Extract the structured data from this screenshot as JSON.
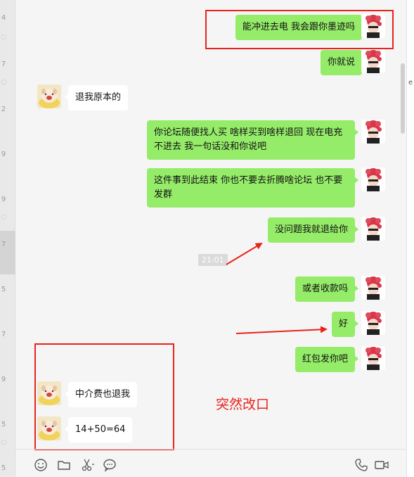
{
  "left_list_fragments": {
    "digits": [
      "4",
      "7",
      "2",
      "9",
      "9",
      "7",
      "5",
      "7",
      "9",
      "5",
      "5"
    ]
  },
  "right_fragment": "e",
  "messages": [
    {
      "sender": "me",
      "text": "能冲进去电 我会跟你墨迹吗"
    },
    {
      "sender": "me",
      "text": "你就说"
    },
    {
      "sender": "other",
      "text": "退我原本的"
    },
    {
      "sender": "me",
      "text": "你论坛随便找人买 啥样买到啥样退回 现在电充不进去 我一句话没和你说吧"
    },
    {
      "sender": "me",
      "text": "这件事到此结束 你也不要去折腾啥论坛 也不要发群"
    },
    {
      "sender": "me",
      "text": "没问题我就退给你"
    },
    {
      "sender": "me",
      "text": "或者收款吗"
    },
    {
      "sender": "me",
      "text": "好"
    },
    {
      "sender": "me",
      "text": "红包发你吧"
    },
    {
      "sender": "other",
      "text": "中介费也退我"
    },
    {
      "sender": "other",
      "text": "14+50=64"
    }
  ],
  "timestamp": "21:01",
  "annotation": "突然改口",
  "toolbar": {
    "left_icons": [
      "emoji-icon",
      "folder-icon",
      "scissors-icon",
      "chat-bubble-icon"
    ],
    "right_icons": [
      "phone-icon",
      "video-icon"
    ]
  },
  "colors": {
    "my_bubble": "#95ec69",
    "other_bubble": "#ffffff",
    "annotation_red": "#e8231c",
    "background": "#f5f5f5"
  }
}
